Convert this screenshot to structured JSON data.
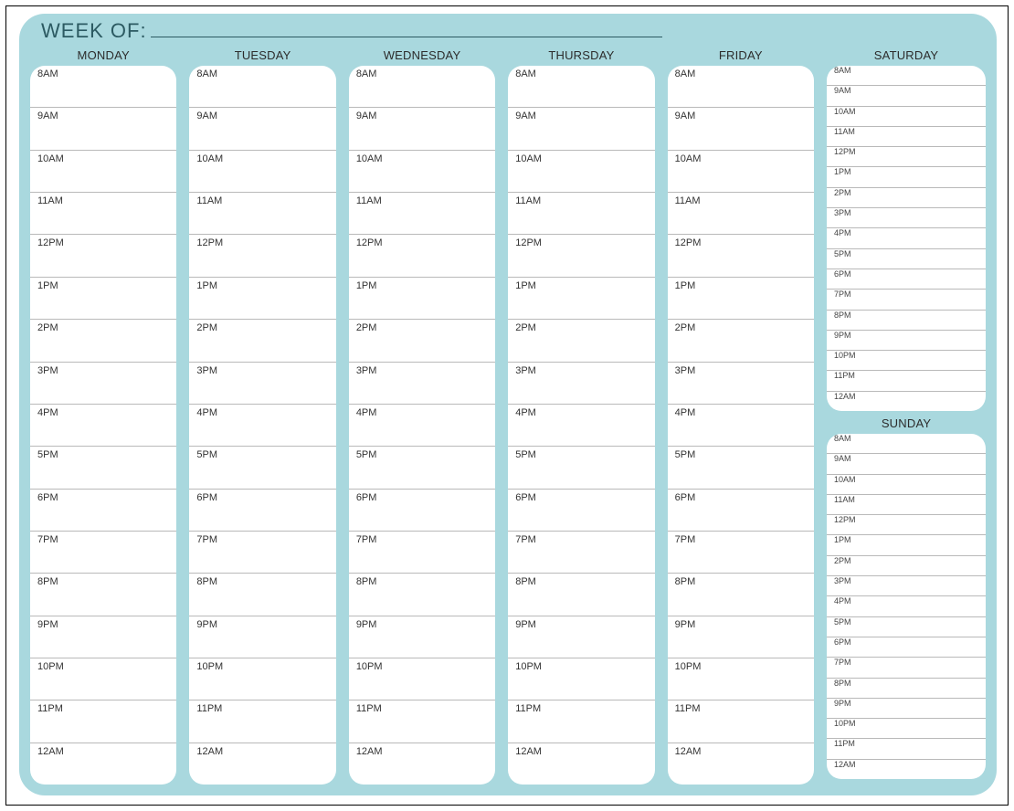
{
  "header": {
    "label": "WEEK OF:"
  },
  "weekdays": [
    {
      "name": "MONDAY"
    },
    {
      "name": "TUESDAY"
    },
    {
      "name": "WEDNESDAY"
    },
    {
      "name": "THURSDAY"
    },
    {
      "name": "FRIDAY"
    }
  ],
  "weekend": [
    {
      "name": "SATURDAY"
    },
    {
      "name": "SUNDAY"
    }
  ],
  "hours": [
    "8AM",
    "9AM",
    "10AM",
    "11AM",
    "12PM",
    "1PM",
    "2PM",
    "3PM",
    "4PM",
    "5PM",
    "6PM",
    "7PM",
    "8PM",
    "9PM",
    "10PM",
    "11PM",
    "12AM"
  ]
}
